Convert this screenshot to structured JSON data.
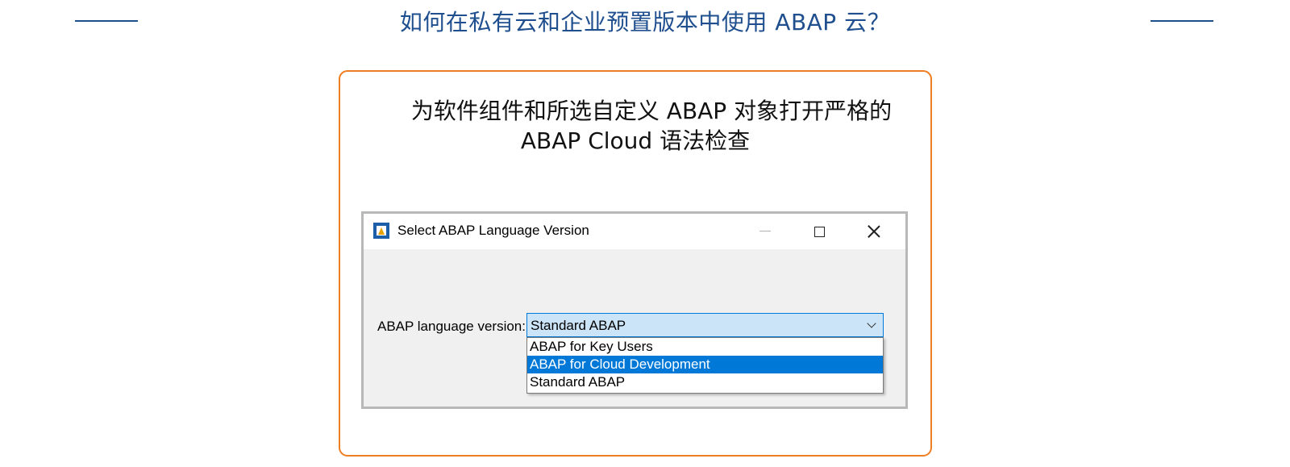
{
  "page": {
    "title": "如何在私有云和企业预置版本中使用 ABAP 云？"
  },
  "card": {
    "headline_line1": "为软件组件和所选自定义 ABAP 对象打开严格的",
    "headline_line2": "ABAP Cloud 语法检查"
  },
  "dialog": {
    "title": "Select ABAP Language Version",
    "icon": "abap-app-icon",
    "controls": [
      "minimize-icon",
      "maximize-icon",
      "close-icon"
    ],
    "field_label": "ABAP language version:",
    "selected_value": "Standard ABAP",
    "options": [
      {
        "label": "ABAP for Key Users",
        "highlighted": false
      },
      {
        "label": "ABAP for Cloud Development",
        "highlighted": true
      },
      {
        "label": "Standard ABAP",
        "highlighted": false
      }
    ]
  },
  "colors": {
    "title_blue": "#1f4f8f",
    "card_border_orange": "#ef7d22",
    "highlight_blue": "#0078d7",
    "combo_bg": "#cce4f7"
  }
}
